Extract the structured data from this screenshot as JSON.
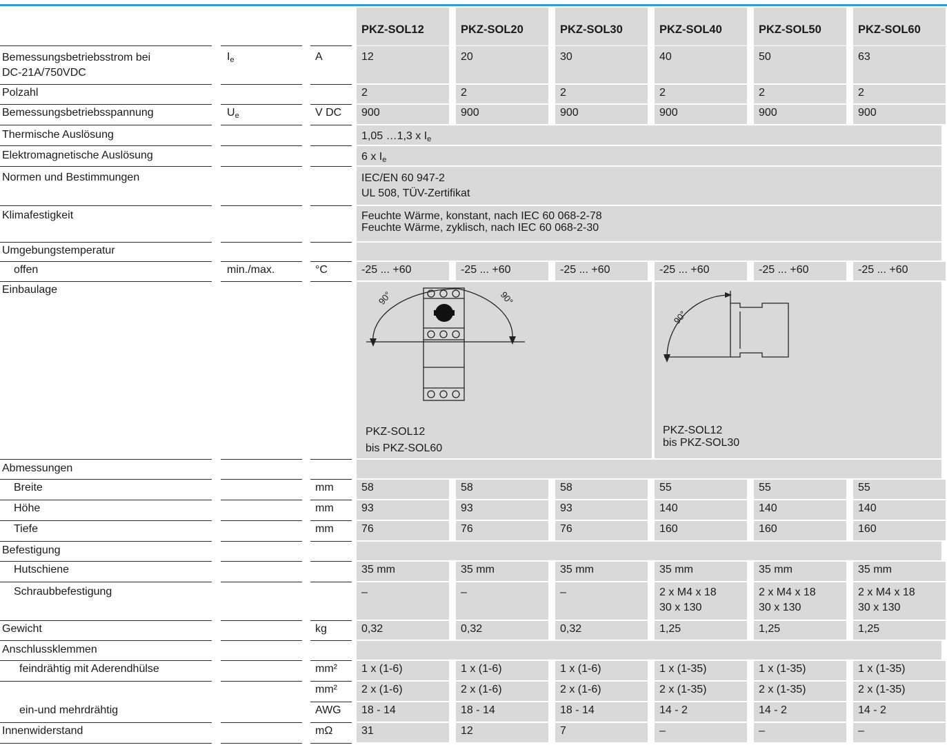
{
  "columns": [
    "PKZ-SOL12",
    "PKZ-SOL20",
    "PKZ-SOL30",
    "PKZ-SOL40",
    "PKZ-SOL50",
    "PKZ-SOL60"
  ],
  "rows": {
    "current": {
      "label_line1": "Bemessungsbetriebsstrom bei",
      "label_line2": "DC-21A/750VDC",
      "symbol": "I",
      "symbol_sub": "e",
      "unit": "A",
      "values": [
        "12",
        "20",
        "30",
        "40",
        "50",
        "63"
      ]
    },
    "poles": {
      "label": "Polzahl",
      "values": [
        "2",
        "2",
        "2",
        "2",
        "2",
        "2"
      ]
    },
    "voltage": {
      "label": "Bemessungsbetriebsspannung",
      "symbol": "U",
      "symbol_sub": "e",
      "unit": "V DC",
      "values": [
        "900",
        "900",
        "900",
        "900",
        "900",
        "900"
      ]
    },
    "thermal": {
      "label": "Thermische Auslösung",
      "value_text": "1,05 …1,3 x I",
      "value_sub": "e"
    },
    "magnetic": {
      "label": "Elektromagnetische Auslösung",
      "value_text": "6 x I",
      "value_sub": "e"
    },
    "standards": {
      "label": "Normen und Bestimmungen",
      "line1": "IEC/EN 60 947-2",
      "line2": "UL 508, TÜV-Zertifikat"
    },
    "climate": {
      "label": "Klimafestigkeit",
      "line1": "Feuchte Wärme, konstant, nach IEC 60 068-2-78",
      "line2": "Feuchte Wärme, zyklisch, nach IEC 60 068-2-30"
    },
    "ambient": {
      "label": "Umgebungstemperatur"
    },
    "open": {
      "label": "offen",
      "symbol": "min./max.",
      "unit": "°C",
      "values": [
        "-25 ... +60",
        "-25 ... +60",
        "-25 ... +60",
        "-25 ... +60",
        "-25 ... +60",
        "-25 ... +60"
      ]
    },
    "mounting": {
      "label": "Einbaulage",
      "angle": "90°",
      "cap1_line1": "PKZ-SOL12",
      "cap1_line2": "bis PKZ-SOL60",
      "cap2_line1": "PKZ-SOL12",
      "cap2_line2": "bis PKZ-SOL30"
    },
    "dimensions": {
      "label": "Abmessungen"
    },
    "width": {
      "label": "Breite",
      "unit": "mm",
      "values": [
        "58",
        "58",
        "58",
        "55",
        "55",
        "55"
      ]
    },
    "height": {
      "label": "Höhe",
      "unit": "mm",
      "values": [
        "93",
        "93",
        "93",
        "140",
        "140",
        "140"
      ]
    },
    "depth": {
      "label": "Tiefe",
      "unit": "mm",
      "values": [
        "76",
        "76",
        "76",
        "160",
        "160",
        "160"
      ]
    },
    "fixing": {
      "label": "Befestigung"
    },
    "rail": {
      "label": "Hutschiene",
      "values": [
        "35 mm",
        "35 mm",
        "35 mm",
        "35 mm",
        "35 mm",
        "35 mm"
      ]
    },
    "screw": {
      "label": "Schraubbefestigung",
      "values_line1": [
        "–",
        "–",
        "–",
        "2 x M4 x 18",
        "2 x M4 x 18",
        "2 x M4 x 18"
      ],
      "values_line2": [
        "",
        "",
        "",
        "30 x 130",
        "30 x 130",
        "30 x 130"
      ]
    },
    "weight": {
      "label": "Gewicht",
      "unit": "kg",
      "values": [
        "0,32",
        "0,32",
        "0,32",
        "1,25",
        "1,25",
        "1,25"
      ]
    },
    "terminals": {
      "label": "Anschlussklemmen"
    },
    "fine1": {
      "label": "feindrähtig mit Aderendhülse",
      "unit": "mm²",
      "values": [
        "1 x (1-6)",
        "1 x (1-6)",
        "1 x (1-6)",
        "1 x (1-35)",
        "1 x (1-35)",
        "1 x (1-35)"
      ]
    },
    "fine2": {
      "unit": "mm²",
      "values": [
        "2 x (1-6)",
        "2 x (1-6)",
        "2 x (1-6)",
        "2 x (1-35)",
        "2 x (1-35)",
        "2 x (1-35)"
      ]
    },
    "awg": {
      "label": "ein-und mehrdrähtig",
      "unit": "AWG",
      "values": [
        "18 - 14",
        "18 - 14",
        "18 - 14",
        "14 - 2",
        "14 - 2",
        "14 - 2"
      ]
    },
    "resistance": {
      "label": "Innenwiderstand",
      "unit": "mΩ",
      "values": [
        "31",
        "12",
        "7",
        "–",
        "–",
        "–"
      ]
    }
  },
  "colors": {
    "accent": "#2f9bd9",
    "cell_gray": "#d9d9d9"
  }
}
